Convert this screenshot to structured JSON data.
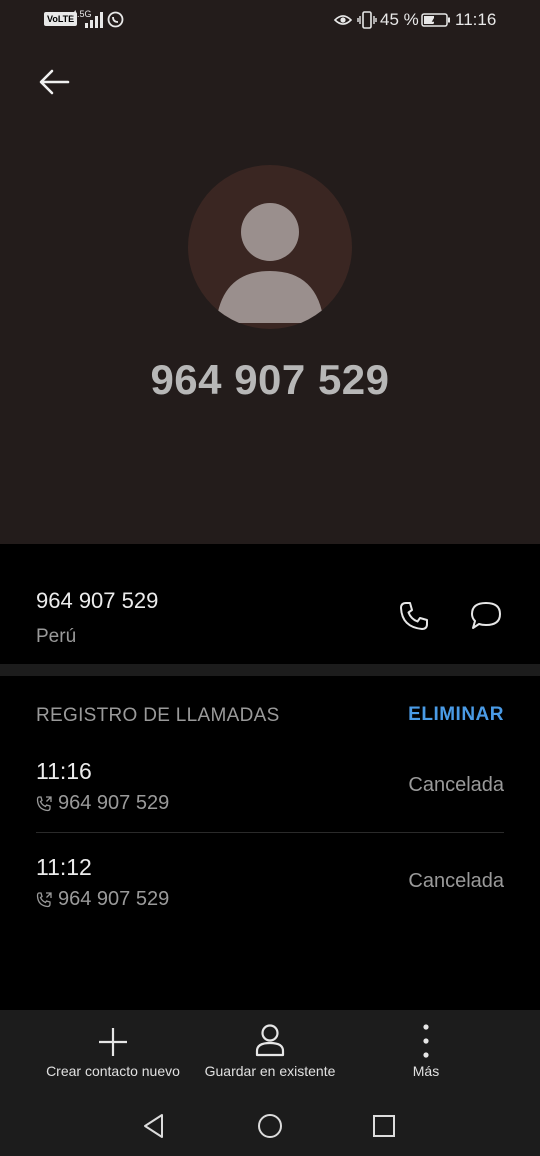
{
  "status_bar": {
    "volte": "VoLTE",
    "network": "4.5G",
    "battery_text": "45 %",
    "time": "11:16"
  },
  "contact": {
    "title": "964 907 529",
    "number": "964 907 529",
    "location": "Perú"
  },
  "call_log": {
    "section_title": "REGISTRO DE LLAMADAS",
    "delete_label": "ELIMINAR",
    "entries": [
      {
        "time": "11:16",
        "number": "964 907 529",
        "status": "Cancelada"
      },
      {
        "time": "11:12",
        "number": "964 907 529",
        "status": "Cancelada"
      }
    ]
  },
  "actions": {
    "new_contact": "Crear contacto nuevo",
    "save_existing": "Guardar en existente",
    "more": "Más"
  },
  "icons": [
    "back-arrow-icon",
    "person-icon",
    "phone-icon",
    "message-icon",
    "plus-icon",
    "more-vert-icon"
  ],
  "colors": {
    "header_bg": "#231c1b",
    "accent": "#4a9be6",
    "background": "#000000"
  }
}
